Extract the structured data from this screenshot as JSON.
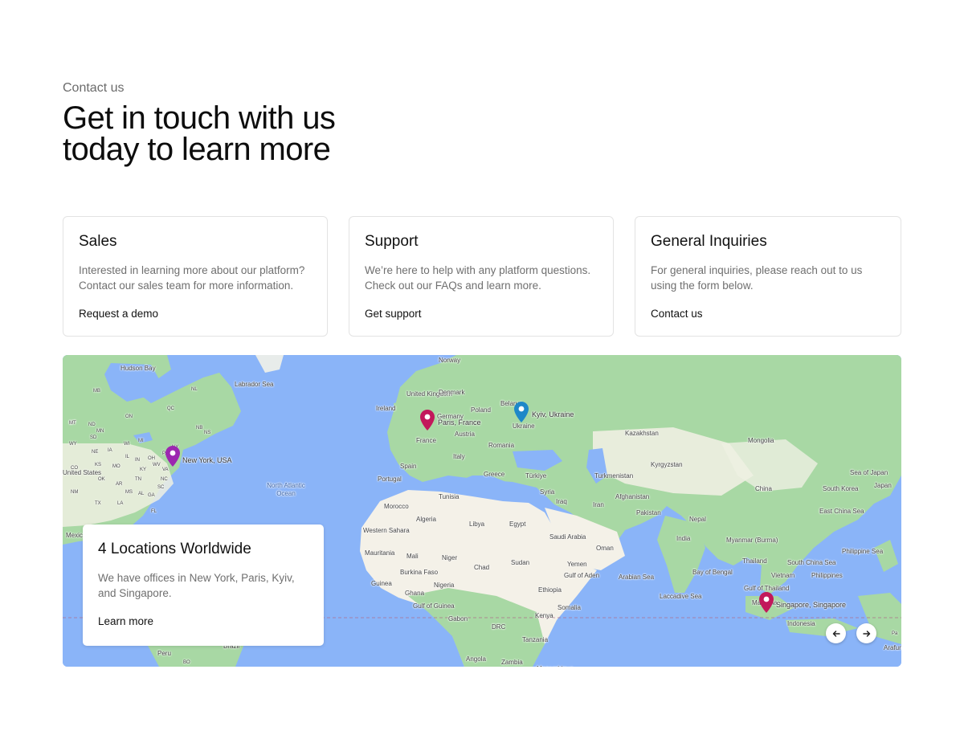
{
  "header": {
    "eyebrow": "Contact us",
    "title": "Get in touch with us today to learn more"
  },
  "cards": [
    {
      "title": "Sales",
      "description": "Interested in learning more about our platform? Contact our sales team for more information.",
      "link": "Request a demo"
    },
    {
      "title": "Support",
      "description": "We’re here to help with any platform questions. Check out our FAQs and learn more.",
      "link": "Get support"
    },
    {
      "title": "General Inquiries",
      "description": "For general inquiries, please reach out to us using the form below.",
      "link": "Contact us"
    }
  ],
  "map": {
    "overlay": {
      "title": "4 Locations Worldwide",
      "description": "We have offices in New York, Paris, Kyiv, and Singapore.",
      "link": "Learn more"
    },
    "pins": [
      {
        "label": "New York, USA",
        "color": "#9c27b0"
      },
      {
        "label": "Paris, France",
        "color": "#c2185b"
      },
      {
        "label": "Kyiv, Ukraine",
        "color": "#1e88c8"
      },
      {
        "label": "Singapore, Singapore",
        "color": "#c2185b"
      }
    ],
    "place_labels": [
      "Hudson Bay",
      "Labrador Sea",
      "Norway",
      "United Kingdom",
      "Denmark",
      "Ireland",
      "Belarus",
      "Poland",
      "Germany",
      "Ukraine",
      "Austria",
      "France",
      "Romania",
      "Italy",
      "Spain",
      "Portugal",
      "Greece",
      "Türkiye",
      "Kazakhstan",
      "Mongolia",
      "Kyrgyzstan",
      "Turkmenistan",
      "China",
      "South Korea",
      "Japan",
      "Sea of Japan",
      "East China Sea",
      "Syria",
      "Iraq",
      "Iran",
      "Afghanistan",
      "Pakistan",
      "Nepal",
      "India",
      "Myanmar (Burma)",
      "Thailand",
      "Vietnam",
      "Philippines",
      "Philippine Sea",
      "South China Sea",
      "Gulf of Thailand",
      "Bay of Bengal",
      "Arabian Sea",
      "Laccadive Sea",
      "Indonesia",
      "Malaysia",
      "Arafura Sea",
      "Tunisia",
      "Morocco",
      "Algeria",
      "Libya",
      "Egypt",
      "Western Sahara",
      "Mauritania",
      "Mali",
      "Niger",
      "Chad",
      "Sudan",
      "Saudi Arabia",
      "Oman",
      "Yemen",
      "Gulf of Aden",
      "Ethiopia",
      "Somalia",
      "Kenya",
      "Burkina Faso",
      "Guinea",
      "Ghana",
      "Nigeria",
      "Gulf of Guinea",
      "Gabon",
      "DRC",
      "Tanzania",
      "Angola",
      "Zambia",
      "Mozambique",
      "United States",
      "Mexico",
      "Peru",
      "Brazil",
      "North Atlantic Ocean",
      "MB",
      "ON",
      "QC",
      "NL",
      "NB",
      "NS",
      "MN",
      "WI",
      "MI",
      "IA",
      "IL",
      "IN",
      "OH",
      "PA",
      "NY",
      "MO",
      "KY",
      "WV",
      "VA",
      "NC",
      "TN",
      "SC",
      "AR",
      "MS",
      "AL",
      "GA",
      "LA",
      "FL",
      "TX",
      "OK",
      "KS",
      "NE",
      "SD",
      "ND",
      "CO",
      "NM",
      "MT",
      "WY",
      "BO",
      "MT",
      "Pa"
    ],
    "controls": {
      "prev": "previous",
      "next": "next"
    }
  },
  "colors": {
    "water": "#8ab4f8",
    "land_green": "#a8d8a4",
    "land_desert": "#f4f1e8",
    "accent_text": "#111111",
    "muted_text": "#6f6f6f"
  }
}
